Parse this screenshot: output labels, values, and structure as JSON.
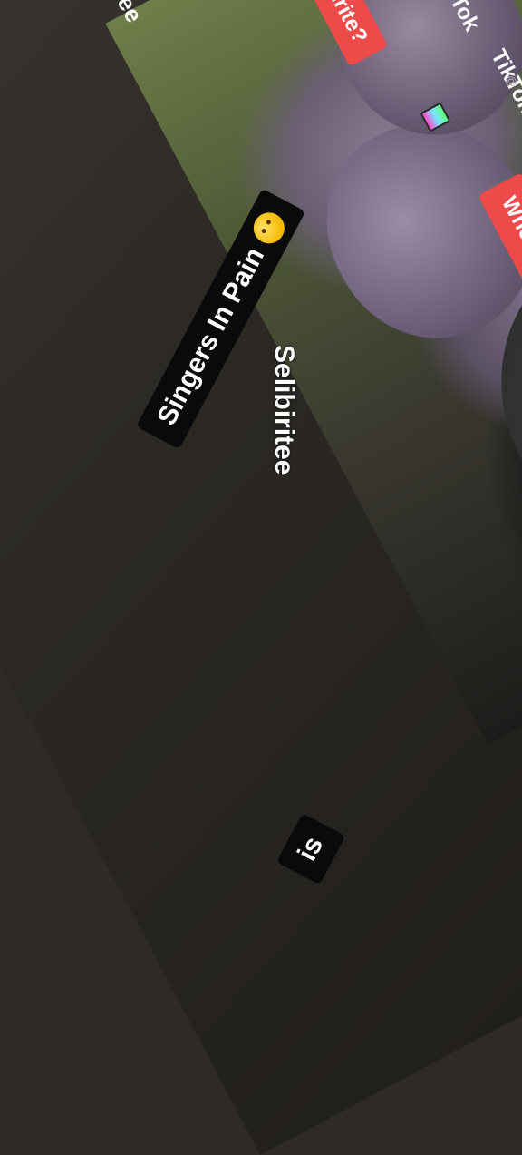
{
  "captions": {
    "creator_name": "Selibiritee",
    "top_fragment": "ee"
  },
  "overlays": {
    "question_main": "Who Is Your Most Favourite?",
    "question_top": "urite?",
    "singers_label": "Singers In Pain",
    "bottom_label": "is"
  },
  "branding": {
    "tiktok_primary": "TikTok",
    "tiktok_secondary": "Tok",
    "handle_small": "@"
  },
  "icons": {
    "favourite_emoji": "frown-emoji-icon",
    "singers_emoji": "emoji-icon"
  },
  "colors": {
    "accent_red": "#ef4a4a",
    "label_black": "#0a0a0a",
    "text_white": "#ffffff"
  }
}
